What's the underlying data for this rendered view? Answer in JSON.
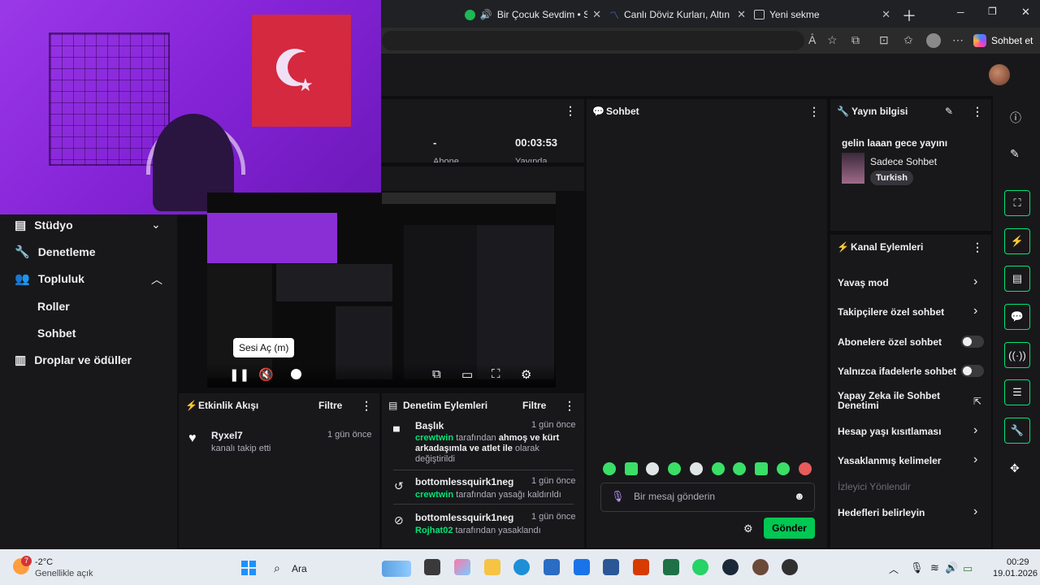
{
  "browser": {
    "tabs": [
      {
        "title": "Bir Çocuk Sevdim • Sezen",
        "icon": "spotify-icon",
        "color": "#1db954"
      },
      {
        "title": "Canlı Döviz Kurları, Altın Fiyat",
        "icon": "chart-icon",
        "color": "#4f8cff"
      },
      {
        "title": "Yeni sekme",
        "icon": "newtab-icon",
        "color": "#9aa0a6"
      }
    ],
    "ai_button": "Sohbet et"
  },
  "stats": {
    "dash": "-",
    "timer": "00:03:53",
    "label1": "Abone Sayısı",
    "label2": "Yayında"
  },
  "left_nav": {
    "items": [
      {
        "label": "Stüdyo",
        "icon": "studio-icon",
        "chevron": "down"
      },
      {
        "label": "Denetleme",
        "icon": "wrench-icon"
      },
      {
        "label": "Topluluk",
        "icon": "community-icon",
        "chevron": "up"
      },
      {
        "label": "Roller",
        "sub": true
      },
      {
        "label": "Sohbet",
        "sub": true
      },
      {
        "label": "Droplar ve ödüller",
        "icon": "drops-icon"
      }
    ]
  },
  "video": {
    "tooltip": "Sesi Aç (m)"
  },
  "activity_feed": {
    "title": "Etkinlik Akışı",
    "filter": "Filtre",
    "items": [
      {
        "user": "Ryxel7",
        "time": "1 gün önce",
        "action": "kanalı takip etti"
      }
    ]
  },
  "mod_actions": {
    "title": "Denetim Eylemleri",
    "filter": "Filtre",
    "items": [
      {
        "title": "Başlık",
        "time": "1 gün önce",
        "actor": "crewtwin",
        "text1": "tarafından",
        "bold": "ahmoş ve kürt arkadaşımla ve atlet ile",
        "text2": "olarak değiştirildi"
      },
      {
        "title": "bottomlessquirk1neg",
        "time": "1 gün önce",
        "actor": "crewtwin",
        "text": "tarafından yasağı kaldırıldı"
      },
      {
        "title": "bottomlessquirk1neg",
        "time": "1 gün önce",
        "actor": "Rojhat02",
        "text": "tarafından yasaklandı"
      }
    ]
  },
  "chat": {
    "title": "Sohbet",
    "placeholder": "Bir mesaj gönderin",
    "send": "Gönder"
  },
  "stream_info": {
    "title": "Yayın bilgisi",
    "stream_title": "gelin laaan gece yayını",
    "category": "Sadece Sohbet",
    "tag": "Turkish"
  },
  "channel_actions": {
    "title": "Kanal Eylemleri",
    "rows": [
      {
        "label": "Yavaş mod",
        "type": "chevron"
      },
      {
        "label": "Takipçilere özel sohbet",
        "type": "chevron"
      },
      {
        "label": "Abonelere özel sohbet",
        "type": "toggle",
        "on": false
      },
      {
        "label": "Yalnızca ifadelerle sohbet",
        "type": "toggle",
        "on": false
      },
      {
        "label": "Yapay Zeka ile Sohbet Denetimi",
        "type": "external"
      },
      {
        "label": "Hesap yaşı kısıtlaması",
        "type": "chevron"
      },
      {
        "label": "Yasaklanmış kelimeler",
        "type": "chevron"
      },
      {
        "label": "İzleyici Yönlendir",
        "type": "disabled"
      },
      {
        "label": "Hedefleri belirleyin",
        "type": "chevron"
      }
    ]
  },
  "taskbar": {
    "weather_temp": "-2°C",
    "weather_text": "Genellikle açık",
    "weather_badge": "7",
    "search": "Ara",
    "time": "00:29",
    "date": "19.01.2026"
  }
}
